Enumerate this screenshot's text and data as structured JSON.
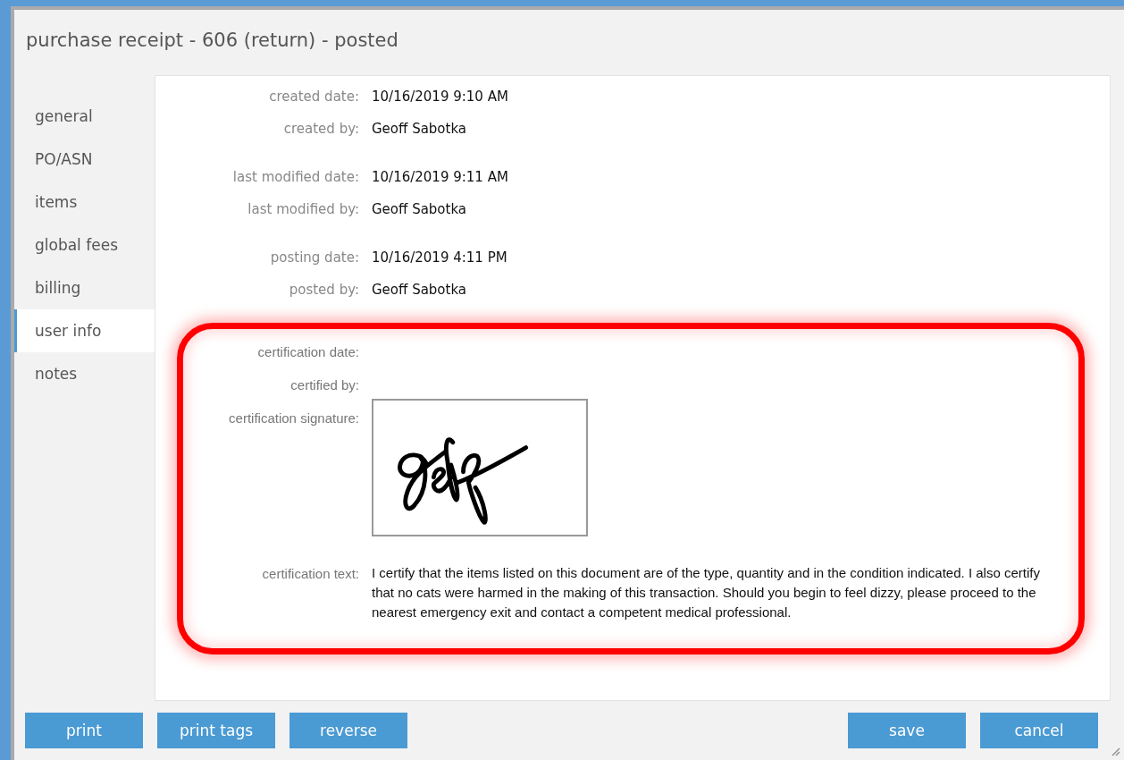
{
  "window": {
    "title": "purchase receipt - 606 (return) - posted"
  },
  "sidebar": {
    "items": [
      {
        "label": "general",
        "selected": false
      },
      {
        "label": "PO/ASN",
        "selected": false
      },
      {
        "label": "items",
        "selected": false
      },
      {
        "label": "global fees",
        "selected": false
      },
      {
        "label": "billing",
        "selected": false
      },
      {
        "label": "user info",
        "selected": true
      },
      {
        "label": "notes",
        "selected": false
      }
    ]
  },
  "field_groups": [
    [
      {
        "label": "created date:",
        "value": "10/16/2019 9:10 AM"
      },
      {
        "label": "created by:",
        "value": "Geoff Sabotka"
      }
    ],
    [
      {
        "label": "last modified date:",
        "value": "10/16/2019 9:11 AM"
      },
      {
        "label": "last modified by:",
        "value": "Geoff Sabotka"
      }
    ],
    [
      {
        "label": "posting date:",
        "value": "10/16/2019 4:11 PM"
      },
      {
        "label": "posted by:",
        "value": "Geoff Sabotka"
      }
    ]
  ],
  "certification": {
    "highlighted": true,
    "fields": [
      {
        "kind": "text",
        "label": "certification date:"
      },
      {
        "kind": "text",
        "label": "certified by:"
      },
      {
        "kind": "signature",
        "label": "certification signature:"
      },
      {
        "kind": "text",
        "label": "certification text:",
        "value": "I certify that the items listed on this document are of the type, quantity and in the condition indicated.  I also certify that no cats were harmed in the making of this transaction.  Should you begin to feel dizzy, please proceed to the nearest emergency exit and contact a competent medical professional."
      }
    ]
  },
  "buttons_left": [
    "print",
    "print tags",
    "reverse"
  ],
  "buttons_right": [
    "save",
    "cancel"
  ]
}
